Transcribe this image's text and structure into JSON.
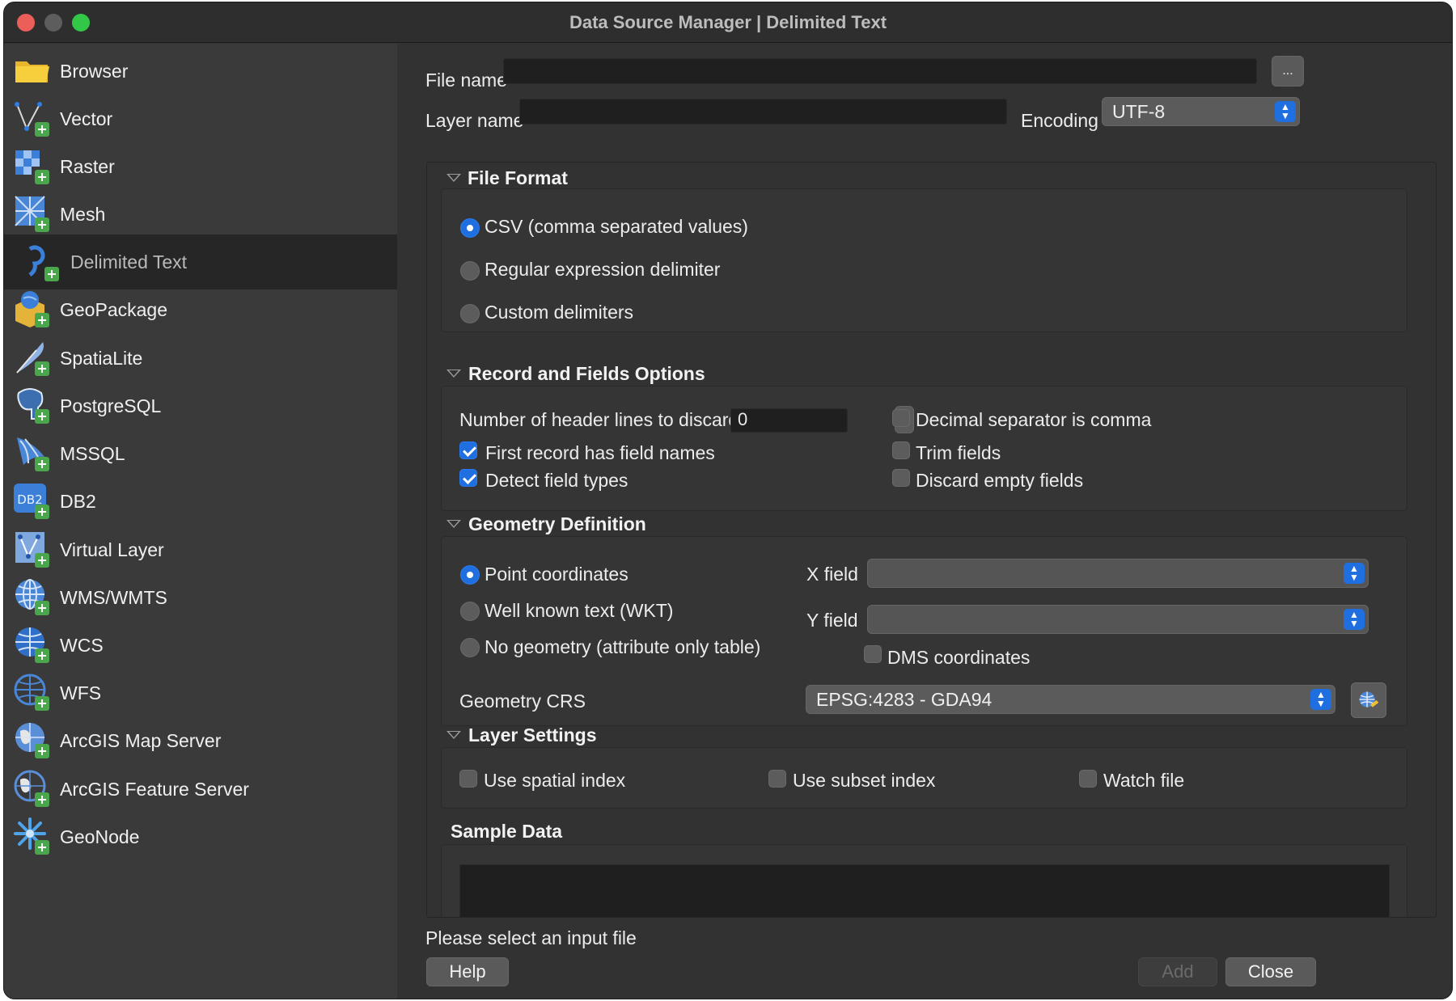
{
  "window": {
    "title": "Data Source Manager | Delimited Text"
  },
  "sidebar": {
    "items": [
      {
        "label": "Browser",
        "icon": "folder-icon"
      },
      {
        "label": "Vector",
        "icon": "vector-icon"
      },
      {
        "label": "Raster",
        "icon": "raster-icon"
      },
      {
        "label": "Mesh",
        "icon": "mesh-icon"
      },
      {
        "label": "Delimited Text",
        "icon": "delimited-text-icon",
        "selected": true
      },
      {
        "label": "GeoPackage",
        "icon": "geopackage-icon"
      },
      {
        "label": "SpatiaLite",
        "icon": "spatialite-icon"
      },
      {
        "label": "PostgreSQL",
        "icon": "postgresql-icon"
      },
      {
        "label": "MSSQL",
        "icon": "mssql-icon"
      },
      {
        "label": "DB2",
        "icon": "db2-icon"
      },
      {
        "label": "Virtual Layer",
        "icon": "virtual-layer-icon"
      },
      {
        "label": "WMS/WMTS",
        "icon": "wms-icon"
      },
      {
        "label": "WCS",
        "icon": "wcs-icon"
      },
      {
        "label": "WFS",
        "icon": "wfs-icon"
      },
      {
        "label": "ArcGIS Map Server",
        "icon": "arcgis-map-icon"
      },
      {
        "label": "ArcGIS Feature Server",
        "icon": "arcgis-feature-icon"
      },
      {
        "label": "GeoNode",
        "icon": "geonode-icon"
      }
    ]
  },
  "form": {
    "file_name_label": "File name",
    "file_name_value": "",
    "browse_label": "...",
    "layer_name_label": "Layer name",
    "layer_name_value": "",
    "encoding_label": "Encoding",
    "encoding_value": "UTF-8"
  },
  "file_format": {
    "title": "File Format",
    "options": [
      "CSV (comma separated values)",
      "Regular expression delimiter",
      "Custom delimiters"
    ],
    "selected": 0
  },
  "record_options": {
    "title": "Record and Fields Options",
    "header_lines_label": "Number of header lines to discard",
    "header_lines_value": "0",
    "first_record_label": "First record has field names",
    "first_record_checked": true,
    "detect_types_label": "Detect field types",
    "detect_types_checked": true,
    "decimal_comma_label": "Decimal separator is comma",
    "decimal_comma_checked": false,
    "trim_fields_label": "Trim fields",
    "trim_fields_checked": false,
    "discard_empty_label": "Discard empty fields",
    "discard_empty_checked": false
  },
  "geometry": {
    "title": "Geometry Definition",
    "options": [
      "Point coordinates",
      "Well known text (WKT)",
      "No geometry (attribute only table)"
    ],
    "selected": 0,
    "x_field_label": "X field",
    "x_field_value": "",
    "y_field_label": "Y field",
    "y_field_value": "",
    "dms_label": "DMS coordinates",
    "dms_checked": false,
    "crs_label": "Geometry CRS",
    "crs_value": "EPSG:4283 - GDA94"
  },
  "layer_settings": {
    "title": "Layer Settings",
    "spatial_index_label": "Use spatial index",
    "subset_index_label": "Use subset index",
    "watch_file_label": "Watch file"
  },
  "sample": {
    "title": "Sample Data"
  },
  "footer": {
    "status": "Please select an input file",
    "help_label": "Help",
    "add_label": "Add",
    "close_label": "Close"
  },
  "colors": {
    "accent": "#1f6fe0",
    "plus_badge": "#49a64a",
    "window_bg": "#323232"
  }
}
